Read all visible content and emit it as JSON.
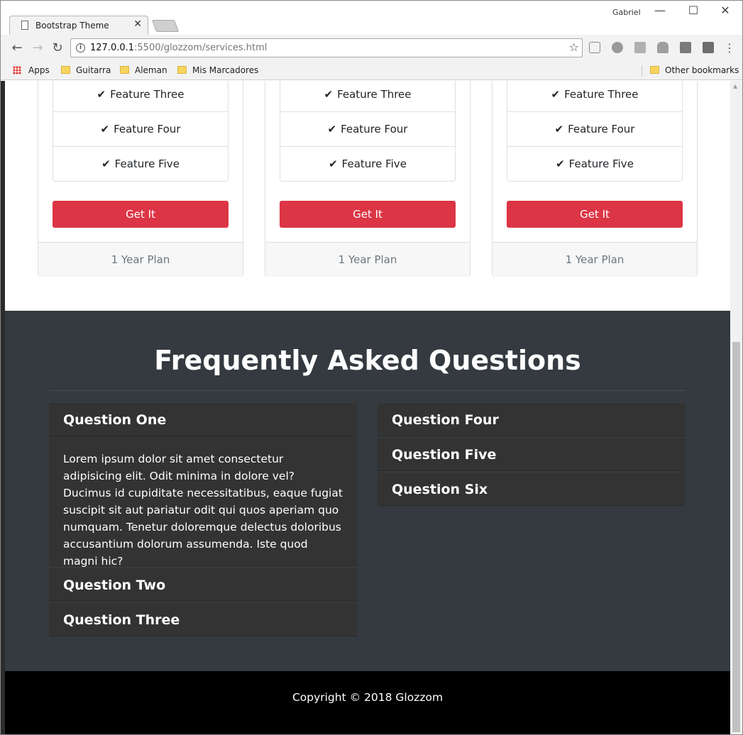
{
  "browser": {
    "tab_title": "Bootstrap Theme",
    "profile_name": "Gabriel",
    "url_host": "127.0.0.1",
    "url_path": ":5500/glozzom/services.html",
    "bookmarks": [
      {
        "label": "Apps"
      },
      {
        "label": "Guitarra"
      },
      {
        "label": "Aleman"
      },
      {
        "label": "Mis Marcadores"
      }
    ],
    "other_bookmarks": "Other bookmarks"
  },
  "pricing": {
    "cards": [
      {
        "features": [
          "Feature Three",
          "Feature Four",
          "Feature Five"
        ],
        "button": "Get It",
        "footer": "1 Year Plan"
      },
      {
        "features": [
          "Feature Three",
          "Feature Four",
          "Feature Five"
        ],
        "button": "Get It",
        "footer": "1 Year Plan"
      },
      {
        "features": [
          "Feature Three",
          "Feature Four",
          "Feature Five"
        ],
        "button": "Get It",
        "footer": "1 Year Plan"
      }
    ]
  },
  "faq": {
    "title": "Frequently Asked Questions",
    "left": [
      {
        "question": "Question One",
        "answer": "Lorem ipsum dolor sit amet consectetur adipisicing elit. Odit minima in dolore vel? Ducimus id cupiditate necessitatibus, eaque fugiat suscipit sit aut pariatur odit qui quos aperiam quo numquam. Tenetur doloremque delectus doloribus accusantium dolorum assumenda. Iste quod magni hic?"
      },
      {
        "question": "Question Two"
      },
      {
        "question": "Question Three"
      }
    ],
    "right": [
      {
        "question": "Question Four"
      },
      {
        "question": "Question Five"
      },
      {
        "question": "Question Six"
      }
    ]
  },
  "footer": {
    "copyright": "Copyright © 2018 Glozzom"
  },
  "colors": {
    "danger": "#dc3545",
    "dark": "#343a40",
    "accordion": "#333333"
  }
}
